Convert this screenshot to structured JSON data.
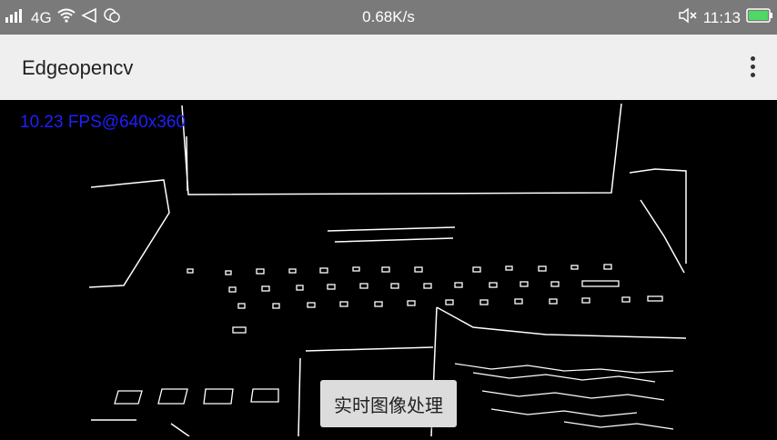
{
  "status_bar": {
    "network": "4G",
    "speed": "0.68K/s",
    "time": "11:13",
    "icons": [
      "signal-icon",
      "wifi-icon",
      "location-icon",
      "message-icon",
      "mute-icon",
      "battery-icon"
    ]
  },
  "app_bar": {
    "title": "Edgeopencv",
    "menu_icon": "overflow-menu-icon"
  },
  "camera": {
    "fps_text": "10.23 FPS@640x360"
  },
  "actions": {
    "process_label": "实时图像处理"
  },
  "colors": {
    "status_bar": "#7a7a7a",
    "app_bar": "#efefef",
    "fps_text": "#1f1fff",
    "battery": "#4cd964"
  }
}
